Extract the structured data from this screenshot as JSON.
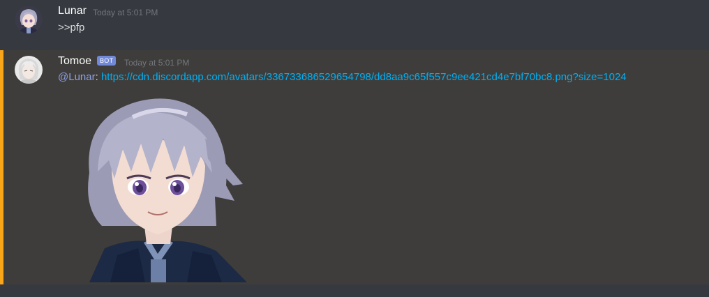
{
  "messages": [
    {
      "author": "Lunar",
      "timestamp": "Today at 5:01 PM",
      "content": ">>pfp",
      "avatar_icon": "anime-girl-avatar-icon"
    },
    {
      "author": "Tomoe",
      "badge": "BOT",
      "timestamp": "Today at 5:01 PM",
      "mention": "@Lunar",
      "separator": ":",
      "link": "https://cdn.discordapp.com/avatars/336733686529654798/dd8aa9c65f557c9ee421cd4e7bf70bc8.png?size=1024",
      "avatar_icon": "white-haired-avatar-icon",
      "attachment_icon": "anime-character-image"
    }
  ],
  "colors": {
    "background": "#36393f",
    "mention_highlight_bg": "#3e3d3b",
    "mention_bar": "#faa61a",
    "bot_badge": "#7289da",
    "link": "#00b0f4",
    "mention": "#8ea1e1"
  }
}
